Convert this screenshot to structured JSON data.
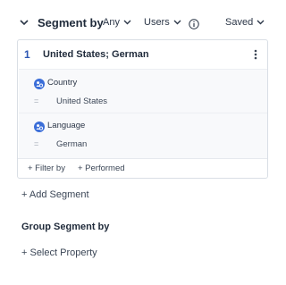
{
  "header": {
    "title": "Segment by",
    "any_label": "Any",
    "users_label": "Users",
    "saved_label": "Saved"
  },
  "segment": {
    "number": "1",
    "name": "United States; German",
    "filters": [
      {
        "property": "Country",
        "operator": "=",
        "value": "United States"
      },
      {
        "property": "Language",
        "operator": "=",
        "value": "German"
      }
    ],
    "filter_by_label": "+ Filter by",
    "performed_label": "+ Performed"
  },
  "add_segment_label": "+ Add Segment",
  "group_segment": {
    "title": "Group Segment by",
    "select_property_label": "+ Select Property"
  },
  "colors": {
    "accent": "#2c56b3",
    "property_icon": "#3b6ed8"
  }
}
